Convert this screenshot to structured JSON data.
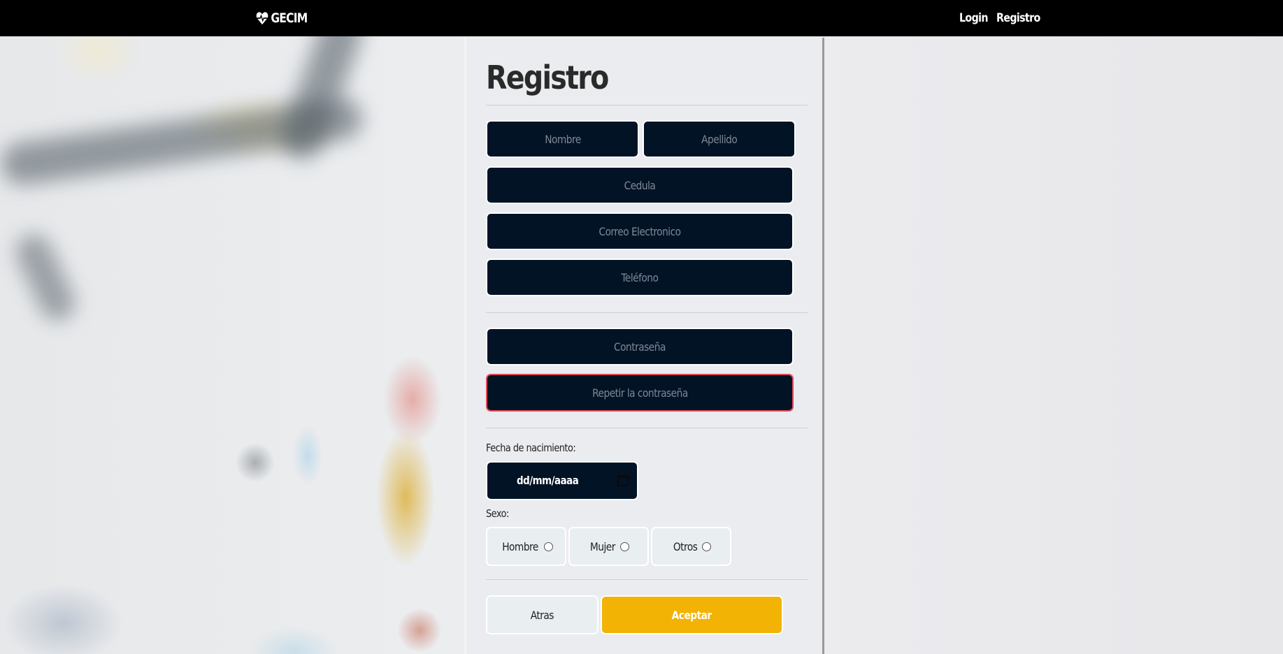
{
  "navbar": {
    "brand": "GECIM",
    "links": [
      {
        "label": "Login"
      },
      {
        "label": "Registro"
      }
    ]
  },
  "form": {
    "title": "Registro",
    "fields": {
      "nombre": {
        "placeholder": "Nombre"
      },
      "apellido": {
        "placeholder": "Apellido"
      },
      "cedula": {
        "placeholder": "Cedula"
      },
      "correo": {
        "placeholder": "Correo Electronico"
      },
      "telefono": {
        "placeholder": "Teléfono"
      },
      "contrasena": {
        "placeholder": "Contraseña"
      },
      "repetir": {
        "placeholder": "Repetir la contraseña"
      }
    },
    "birthdate": {
      "label": "Fecha de nacimiento:",
      "value": "dd/mm/aaaa"
    },
    "sex": {
      "label": "Sexo:",
      "options": [
        "Hombre",
        "Mujer",
        "Otros"
      ]
    },
    "buttons": {
      "back": "Atras",
      "accept": "Aceptar"
    }
  },
  "colors": {
    "navbar": "#000000",
    "input_bg": "#021325",
    "error_border": "#e04b57",
    "accept_button": "#f2b305"
  },
  "icons": {
    "brand": "heart-pulse-icon",
    "date": "calendar-icon"
  }
}
